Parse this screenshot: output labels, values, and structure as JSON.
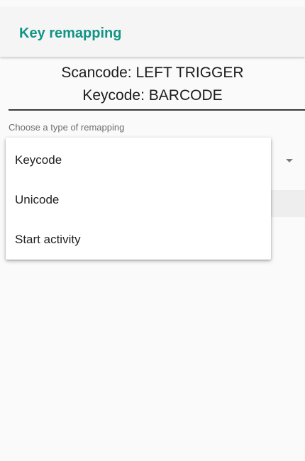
{
  "app_bar": {
    "title": "Key remapping"
  },
  "mapping_info": {
    "scancode_line": "Scancode: LEFT TRIGGER",
    "keycode_line": "Keycode: BARCODE"
  },
  "remap_type": {
    "label": "Choose a type of remapping",
    "options": [
      "Keycode",
      "Unicode",
      "Start activity"
    ],
    "dropdown_icon": "chevron-down-icon"
  },
  "colors": {
    "accent": "#129486",
    "background": "#fafafa",
    "app_bar_background": "#f5f5f5",
    "menu_background": "#ffffff"
  }
}
